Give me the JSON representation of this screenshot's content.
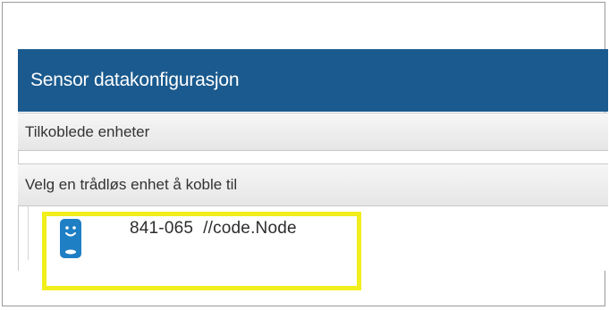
{
  "panel": {
    "title": "Sensor datakonfigurasjon",
    "sections": {
      "connected_label": "Tilkoblede enheter",
      "select_label": "Velg en trådløs enhet å koble til"
    },
    "devices": [
      {
        "icon": "sensor-device-icon",
        "id": "841-065",
        "name": "//code.Node"
      }
    ]
  },
  "colors": {
    "header_bg": "#1a5a8e",
    "header_text": "#ffffff",
    "device_icon": "#1f7fc4",
    "highlight": "#f2ee1b"
  }
}
